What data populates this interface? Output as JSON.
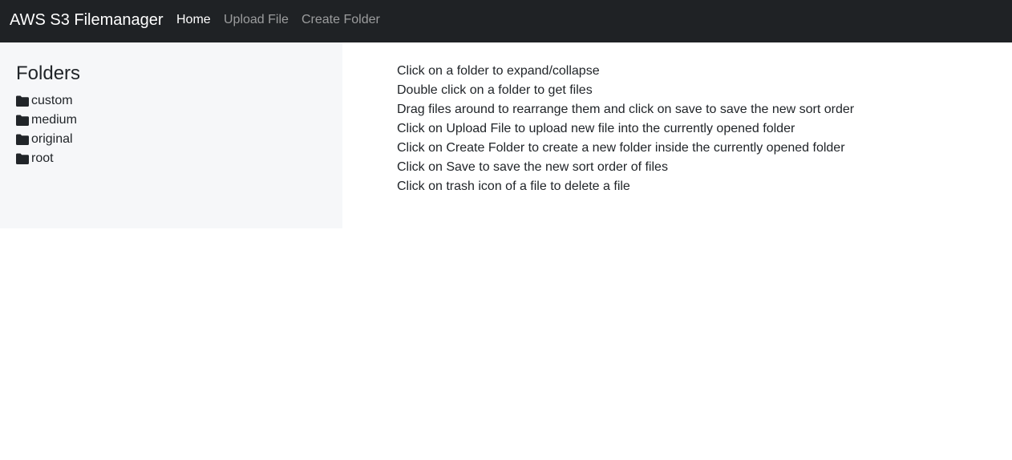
{
  "navbar": {
    "brand": "AWS S3 Filemanager",
    "links": [
      {
        "label": "Home",
        "active": true
      },
      {
        "label": "Upload File",
        "active": false
      },
      {
        "label": "Create Folder",
        "active": false
      }
    ]
  },
  "sidebar": {
    "title": "Folders",
    "folders": [
      {
        "name": "custom",
        "icon": "folder-icon"
      },
      {
        "name": "medium",
        "icon": "folder-icon"
      },
      {
        "name": "original",
        "icon": "folder-icon"
      },
      {
        "name": "root",
        "icon": "folder-icon"
      }
    ]
  },
  "instructions": [
    "Click on a folder to expand/collapse",
    "Double click on a folder to get files",
    "Drag files around to rearrange them and click on save to save the new sort order",
    "Click on Upload File to upload new file into the currently opened folder",
    "Click on Create Folder to create a new folder inside the currently opened folder",
    "Click on Save to save the new sort order of files",
    "Click on trash icon of a file to delete a file"
  ],
  "colors": {
    "navbar_bg": "#1f2225",
    "sidebar_bg": "#f6f7f9",
    "text": "#212529",
    "nav_inactive": "rgba(255,255,255,0.55)"
  }
}
